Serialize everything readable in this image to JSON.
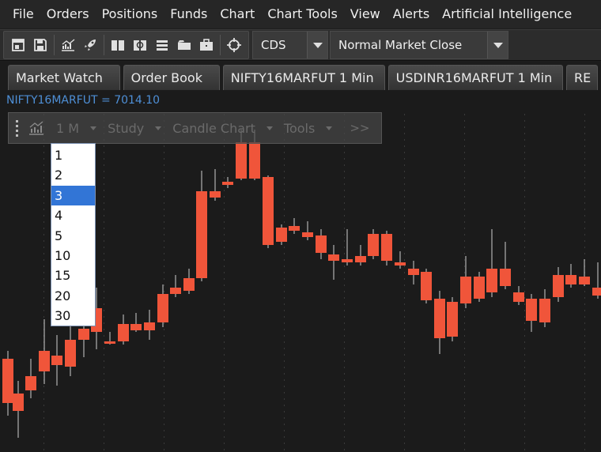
{
  "menu": [
    "File",
    "Orders",
    "Positions",
    "Funds",
    "Chart",
    "Chart Tools",
    "View",
    "Alerts",
    "Artificial Intelligence"
  ],
  "toolbar": {
    "icons": [
      "new-window-icon",
      "save-icon",
      "chart-icon",
      "rocket-icon",
      "book-icon",
      "book-refresh-icon",
      "stack-icon",
      "folder-icon",
      "briefcase-icon",
      "crosshair-icon"
    ],
    "exchange_value": "CDS",
    "market_mode_value": "Normal Market Close"
  },
  "tabs": [
    "Market Watch",
    "Order Book",
    "NIFTY16MARFUT 1 Min",
    "USDINR16MARFUT 1 Min",
    "RE"
  ],
  "chart": {
    "title": "NIFTY16MARFUT = 7014.10",
    "toolbar": {
      "interval": "1 M",
      "study": "Study",
      "chart_type": "Candle Chart",
      "tools": "Tools",
      "more": ">>"
    },
    "colors": {
      "up": "#2ecc40",
      "down": "#f0553a",
      "wick": "#cfcfcf",
      "title": "#4e8fd6"
    }
  },
  "interval_dropdown": {
    "options": [
      "1",
      "2",
      "3",
      "4",
      "5",
      "10",
      "15",
      "20",
      "30"
    ],
    "selected": "3"
  }
}
